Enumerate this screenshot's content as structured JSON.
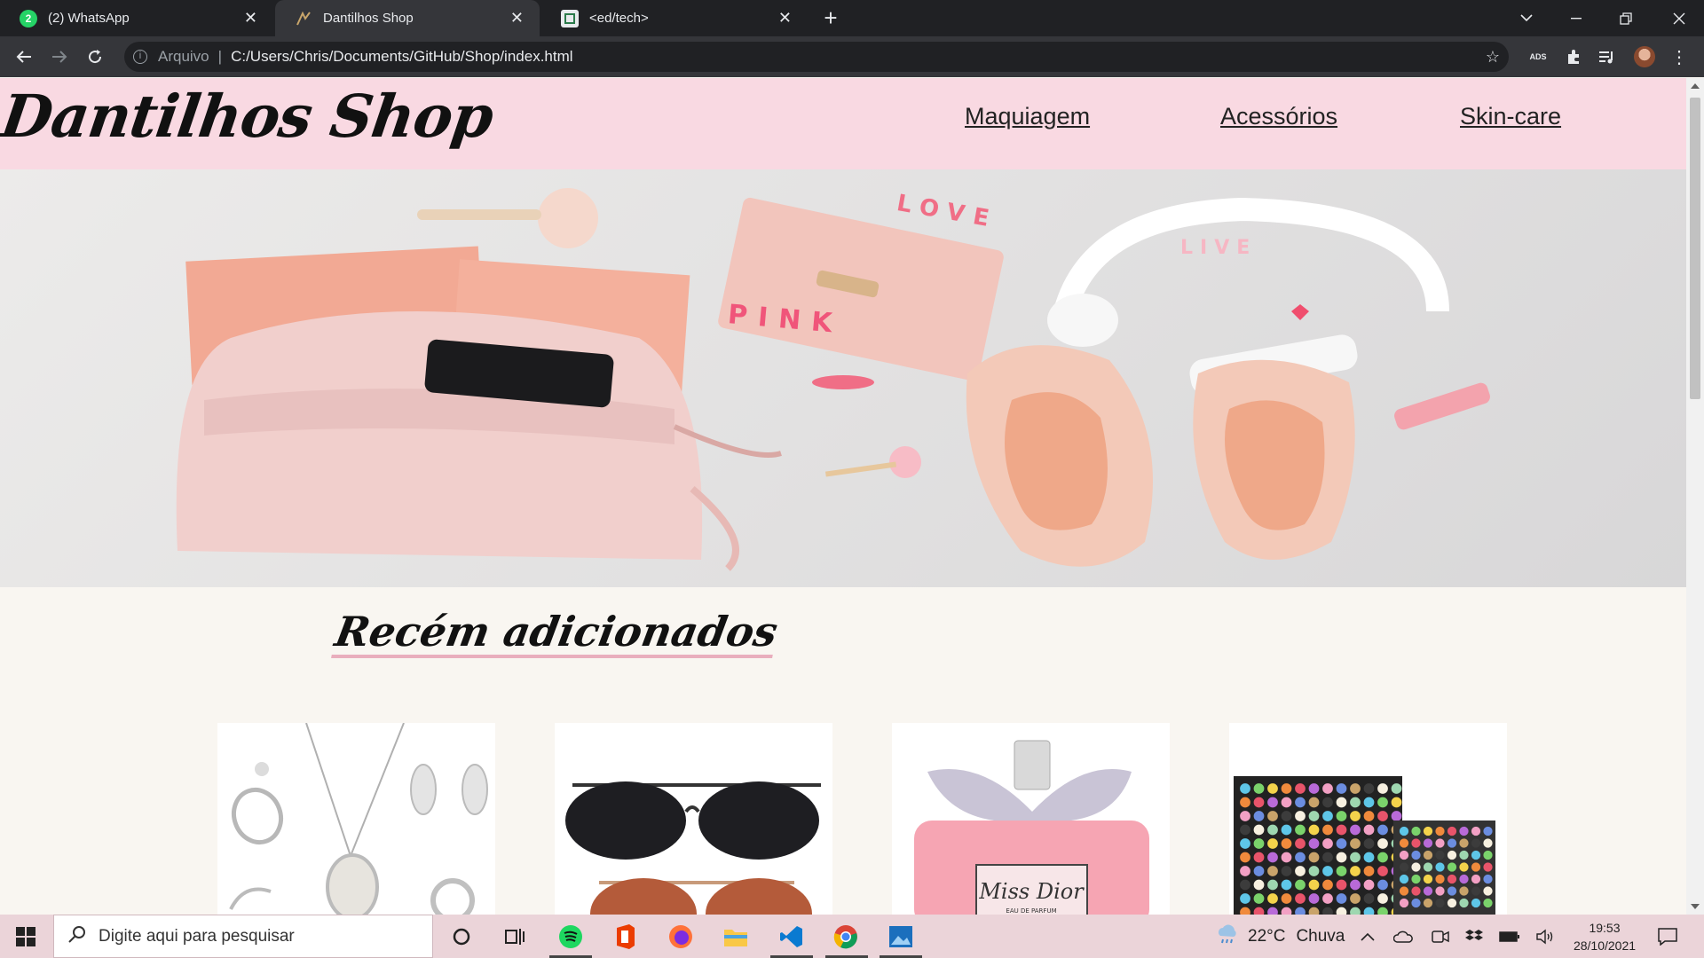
{
  "browser": {
    "tabs": [
      {
        "title": "(2) WhatsApp",
        "icon": "whatsapp-icon",
        "badge": "2"
      },
      {
        "title": "Dantilhos Shop",
        "icon": "shop-favicon"
      },
      {
        "title": "<ed/tech>",
        "icon": "edtech-icon"
      }
    ],
    "close_glyph": "✕",
    "new_tab_glyph": "+",
    "address": {
      "scheme": "Arquivo",
      "separator": "|",
      "url": "C:/Users/Chris/Documents/GitHub/Shop/index.html"
    }
  },
  "site": {
    "logo": "Dantilhos Shop",
    "nav": [
      "Maquiagem",
      "Acessórios",
      "Skin-care"
    ],
    "hero": {
      "words": [
        "LOVE",
        "LIVE",
        "PINK"
      ]
    },
    "section_title": "Recém adicionados",
    "product_cards": [
      {
        "name": "jewelry-set",
        "image_label": ""
      },
      {
        "name": "sunglasses",
        "image_label": ""
      },
      {
        "name": "perfume",
        "image_label": "Miss Dior",
        "image_sub": "EAU DE PARFUM"
      },
      {
        "name": "eyeshadow-palette",
        "image_label": ""
      }
    ]
  },
  "taskbar": {
    "search_placeholder": "Digite aqui para pesquisar",
    "weather": {
      "temp": "22°C",
      "condition": "Chuva"
    },
    "time": "19:53",
    "date": "28/10/2021"
  },
  "colors": {
    "header_pink": "#f9d9e2",
    "accent_underline": "#e9aebd",
    "page_bg": "#f9f6f1",
    "chrome_dark": "#202124",
    "chrome_mid": "#35363a",
    "taskbar": "#ebd4d9"
  }
}
